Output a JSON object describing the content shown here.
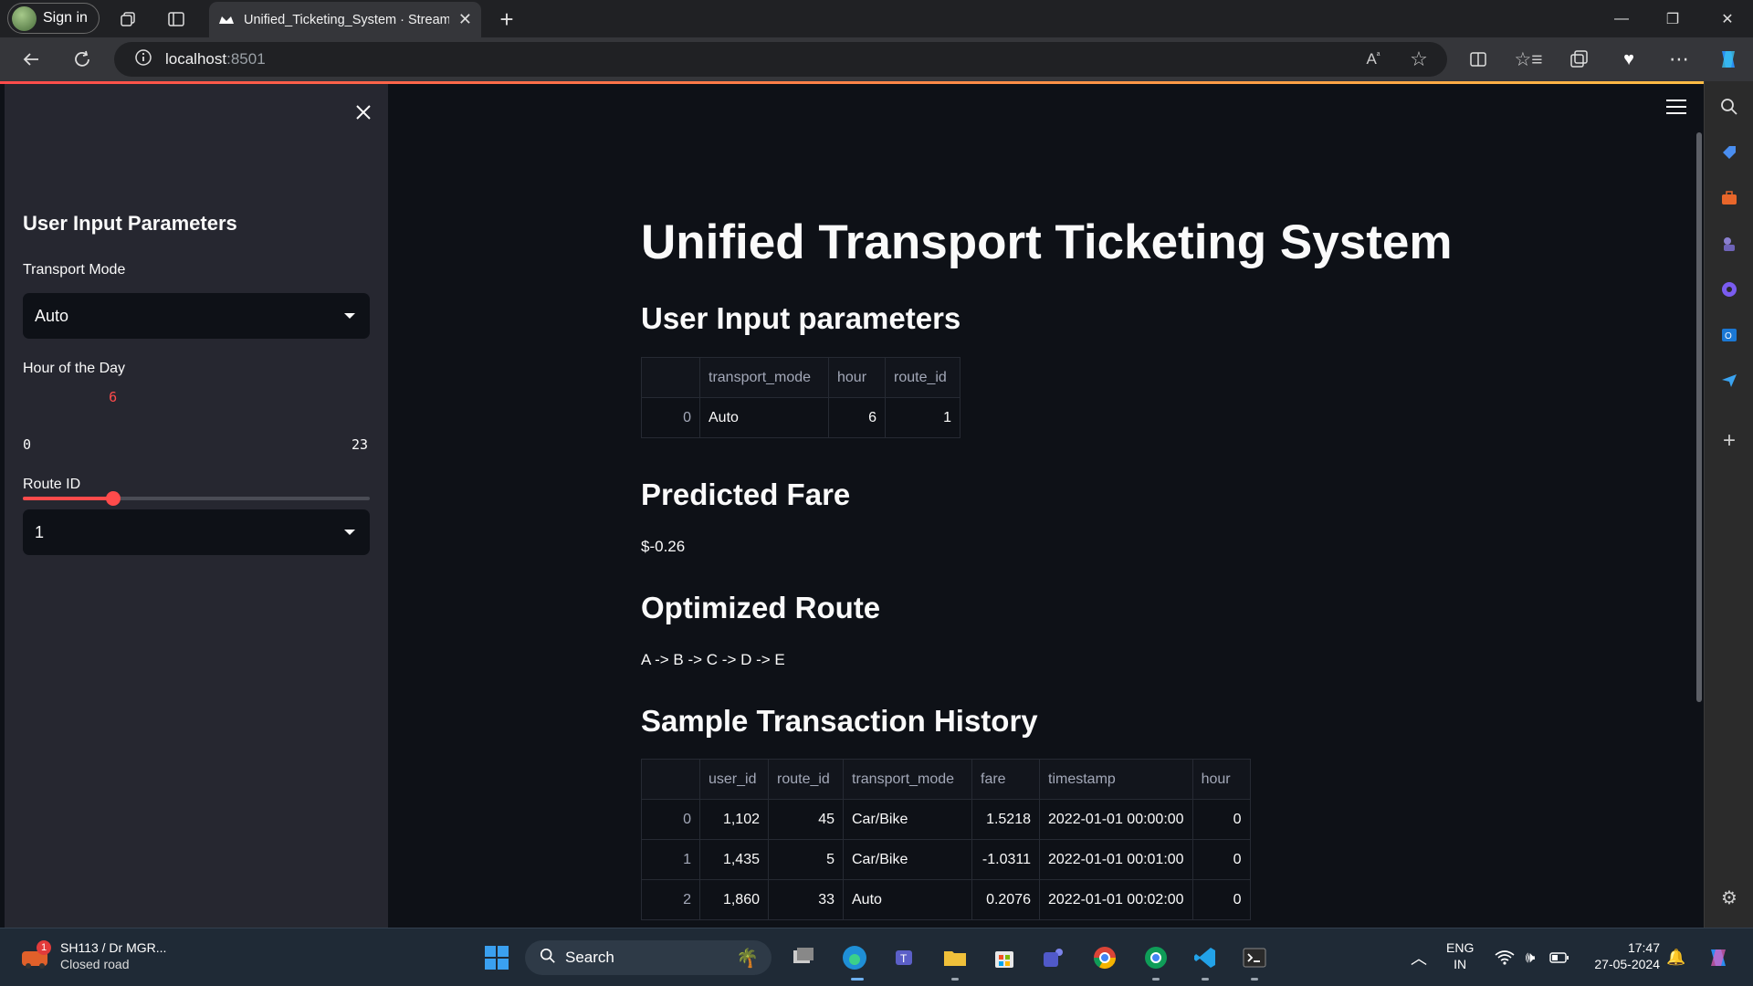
{
  "browser": {
    "signin_label": "Sign in",
    "tab_title": "Unified_Ticketing_System · Streamlit",
    "url_host": "localhost",
    "url_port": ":8501"
  },
  "sidebar": {
    "header": "User Input Parameters",
    "transport_label": "Transport Mode",
    "transport_value": "Auto",
    "hour_label": "Hour of the Day",
    "hour_value": "6",
    "hour_fraction": 0.2609,
    "hour_min": "0",
    "hour_max": "23",
    "route_label": "Route ID",
    "route_value": "1"
  },
  "main": {
    "title": "Unified Transport Ticketing System",
    "params_heading": "User Input parameters",
    "params_table": {
      "columns": [
        "",
        "transport_mode",
        "hour",
        "route_id"
      ],
      "rows": [
        [
          "0",
          "Auto",
          "6",
          "1"
        ]
      ]
    },
    "fare_heading": "Predicted Fare",
    "fare_value": "$-0.26",
    "route_heading": "Optimized Route",
    "route_value": "A -> B -> C -> D -> E",
    "history_heading": "Sample Transaction History",
    "history_table": {
      "columns": [
        "",
        "user_id",
        "route_id",
        "transport_mode",
        "fare",
        "timestamp",
        "hour"
      ],
      "rows": [
        [
          "0",
          "1,102",
          "45",
          "Car/Bike",
          "1.5218",
          "2022-01-01 00:00:00",
          "0"
        ],
        [
          "1",
          "1,435",
          "5",
          "Car/Bike",
          "-1.0311",
          "2022-01-01 00:01:00",
          "0"
        ],
        [
          "2",
          "1,860",
          "33",
          "Auto",
          "0.2076",
          "2022-01-01 00:02:00",
          "0"
        ]
      ]
    }
  },
  "taskbar": {
    "weather_title": "SH113 / Dr MGR...",
    "weather_sub": "Closed road",
    "weather_badge": "1",
    "search_label": "Search",
    "lang_top": "ENG",
    "lang_bottom": "IN",
    "time": "17:47",
    "date": "27-05-2024"
  },
  "colors": {
    "accent": "#ff4b4b",
    "background": "#0e1117",
    "sidebar": "#262730"
  }
}
